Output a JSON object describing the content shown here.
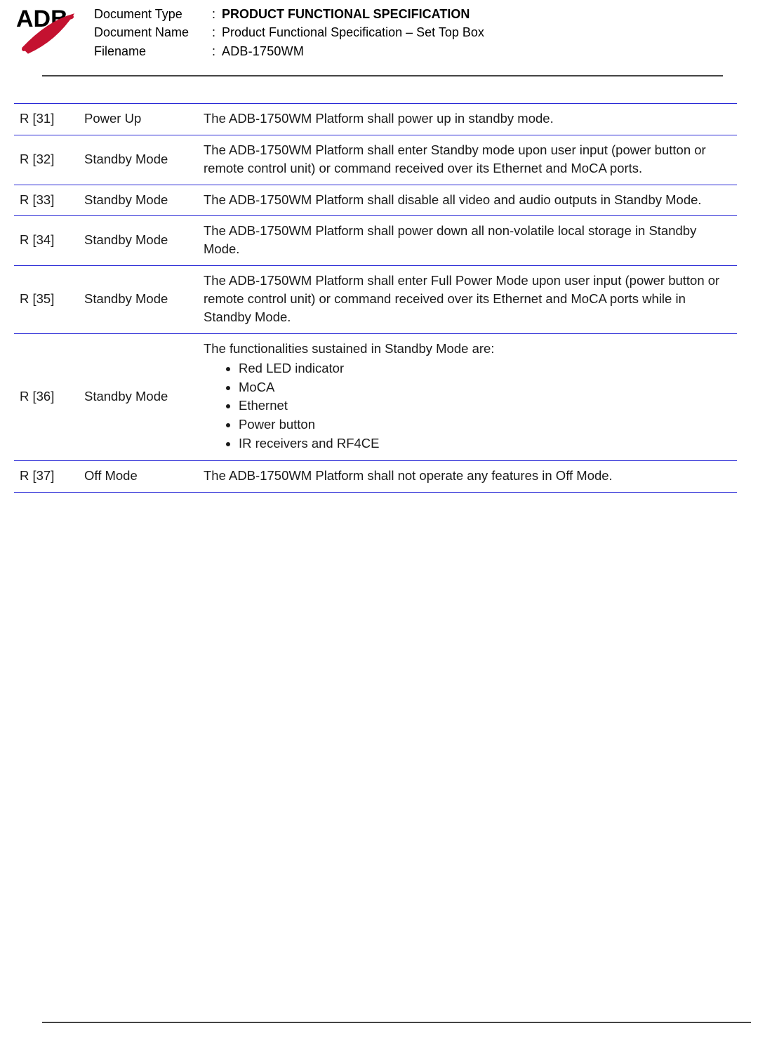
{
  "header": {
    "logo_text": "ADB",
    "rows": [
      {
        "label": "Document Type",
        "value": "PRODUCT FUNCTIONAL SPECIFICATION",
        "bold": true
      },
      {
        "label": "Document Name",
        "value": "Product Functional Specification – Set Top Box",
        "bold": false
      },
      {
        "label": "Filename",
        "value": "ADB-1750WM",
        "bold": false
      }
    ]
  },
  "requirements": [
    {
      "id": "R [31]",
      "category": "Power Up",
      "desc": "The ADB-1750WM Platform shall power up in standby mode."
    },
    {
      "id": "R [32]",
      "category": "Standby Mode",
      "desc": "The ADB-1750WM Platform shall enter Standby mode upon user input (power button or remote control unit) or command received over its Ethernet and MoCA ports."
    },
    {
      "id": "R [33]",
      "category": "Standby Mode",
      "desc": "The ADB-1750WM Platform shall disable all video and audio outputs in Standby Mode."
    },
    {
      "id": "R [34]",
      "category": "Standby Mode",
      "desc": "The ADB-1750WM Platform shall power down all non-volatile local storage in Standby Mode."
    },
    {
      "id": "R [35]",
      "category": "Standby Mode",
      "desc": "The ADB-1750WM Platform shall enter Full Power Mode upon user input (power button or remote control unit) or command received over its Ethernet and MoCA ports while in Standby Mode."
    },
    {
      "id": "R [36]",
      "category": "Standby Mode",
      "desc_intro": "The functionalities sustained in Standby Mode are:",
      "desc_list": [
        "Red LED indicator",
        "MoCA",
        "Ethernet",
        "Power button",
        "IR receivers and RF4CE"
      ]
    },
    {
      "id": "R [37]",
      "category": "Off Mode",
      "desc": "The ADB-1750WM Platform shall not operate any features in Off Mode."
    }
  ]
}
